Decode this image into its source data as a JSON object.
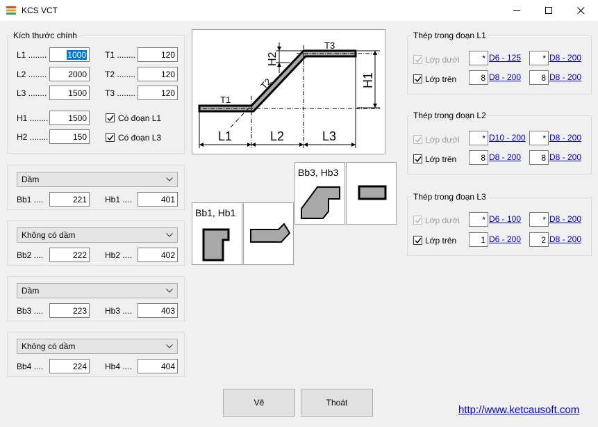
{
  "window": {
    "title": "KCS VCT"
  },
  "main_dims": {
    "group_title": "Kích thước chính",
    "L1": {
      "label": "L1 ........",
      "value": "1000"
    },
    "L2": {
      "label": "L2 ........",
      "value": "2000"
    },
    "L3": {
      "label": "L3 ........",
      "value": "1500"
    },
    "T1": {
      "label": "T1 ........",
      "value": "120"
    },
    "T2": {
      "label": "T2 ........",
      "value": "120"
    },
    "T3": {
      "label": "T3 ........",
      "value": "120"
    },
    "H1": {
      "label": "H1 ........",
      "value": "1500"
    },
    "H2": {
      "label": "H2 ........",
      "value": "150"
    },
    "co_doan_L1": "Có đoạn L1",
    "co_doan_L3": "Có đoạn L3"
  },
  "beams": [
    {
      "type": "Dầm",
      "b_label": "Bb1 ....",
      "b_value": "221",
      "h_label": "Hb1 ....",
      "h_value": "401"
    },
    {
      "type": "Không có dầm",
      "b_label": "Bb2 ....",
      "b_value": "222",
      "h_label": "Hb2 ....",
      "h_value": "402"
    },
    {
      "type": "Dầm",
      "b_label": "Bb3 ....",
      "b_value": "223",
      "h_label": "Hb3 ....",
      "h_value": "403"
    },
    {
      "type": "Không có dầm",
      "b_label": "Bb4 ....",
      "b_value": "224",
      "h_label": "Hb4 ....",
      "h_value": "404"
    }
  ],
  "diagram": {
    "T1": "T1",
    "T2": "T2",
    "T3": "T3",
    "H1": "H1",
    "H2": "H2",
    "L1": "L1",
    "L2": "L2",
    "L3": "L3"
  },
  "previews": {
    "bb1_label": "Bb1, Hb1",
    "bb3_label": "Bb3, Hb3"
  },
  "steel_groups": [
    {
      "title": "Thép trong đoạn L1",
      "lower": {
        "label": "Lớp dưới",
        "qty": "*",
        "spec": "D6 - 125",
        "qty2": "*",
        "spec2": "D8 - 200"
      },
      "upper": {
        "label": "Lớp trên",
        "qty": "8",
        "spec": "D8 - 200",
        "qty2": "8",
        "spec2": "D8 - 200"
      }
    },
    {
      "title": "Thép trong đoạn L2",
      "lower": {
        "label": "Lớp dưới",
        "qty": "*",
        "spec": "D10 - 200",
        "qty2": "*",
        "spec2": "D8 - 200"
      },
      "upper": {
        "label": "Lớp trên",
        "qty": "8",
        "spec": "D8 - 200",
        "qty2": "8",
        "spec2": "D8 - 200"
      }
    },
    {
      "title": "Thép trong đoạn L3",
      "lower": {
        "label": "Lớp dưới",
        "qty": "*",
        "spec": "D6 - 100",
        "qty2": "*",
        "spec2": "D8 - 200"
      },
      "upper": {
        "label": "Lớp trên",
        "qty": "1",
        "spec": "D6 - 200",
        "qty2": "2",
        "spec2": "D8 - 200"
      }
    }
  ],
  "buttons": {
    "draw": "Vẽ",
    "exit": "Thoát"
  },
  "website": "http://www.ketcausoft.com"
}
